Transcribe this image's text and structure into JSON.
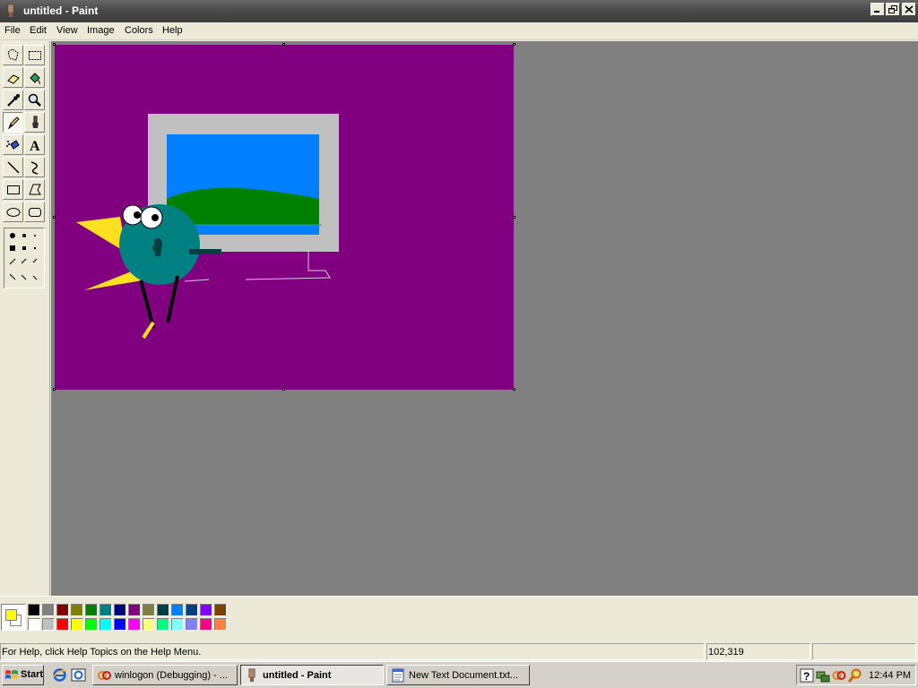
{
  "window": {
    "title": "untitled - Paint",
    "app_icon": "paint-brush-icon"
  },
  "menu": {
    "items": [
      "File",
      "Edit",
      "View",
      "Image",
      "Colors",
      "Help"
    ]
  },
  "toolbox": {
    "tools": [
      {
        "name": "free-form-select-icon"
      },
      {
        "name": "select-icon"
      },
      {
        "name": "eraser-icon"
      },
      {
        "name": "fill-with-color-icon"
      },
      {
        "name": "pick-color-icon"
      },
      {
        "name": "magnifier-icon"
      },
      {
        "name": "pencil-icon",
        "active": true
      },
      {
        "name": "brush-icon"
      },
      {
        "name": "airbrush-icon"
      },
      {
        "name": "text-icon",
        "glyph": "A"
      },
      {
        "name": "line-icon"
      },
      {
        "name": "curve-icon"
      },
      {
        "name": "rectangle-icon"
      },
      {
        "name": "polygon-icon"
      },
      {
        "name": "ellipse-icon"
      },
      {
        "name": "rounded-rectangle-icon"
      }
    ]
  },
  "colors": {
    "foreground": "#ffff00",
    "background": "#ffffff",
    "canvas": "#800080",
    "palette_top": [
      "#000000",
      "#808080",
      "#800000",
      "#808000",
      "#008000",
      "#008080",
      "#000080",
      "#800080",
      "#808040",
      "#004040",
      "#0080ff",
      "#004080",
      "#8000ff",
      "#804000"
    ],
    "palette_bottom": [
      "#ffffff",
      "#c0c0c0",
      "#ff0000",
      "#ffff00",
      "#00ff00",
      "#00ffff",
      "#0000ff",
      "#ff00ff",
      "#ffff80",
      "#00ff80",
      "#80ffff",
      "#8080ff",
      "#ff0080",
      "#ff8040"
    ]
  },
  "status": {
    "help_text": "For Help, click Help Topics on the Help Menu.",
    "coordinates": "102,319",
    "size": ""
  },
  "taskbar": {
    "start_label": "Start",
    "quick_launch": [
      "internet-explorer-icon",
      "desktop-icon"
    ],
    "tasks": [
      {
        "label": "winlogon (Debugging) - ...",
        "icon": "debugger-icon",
        "active": false
      },
      {
        "label": "untitled - Paint",
        "icon": "paint-brush-icon",
        "active": true
      },
      {
        "label": "New Text Document.txt...",
        "icon": "notepad-icon",
        "active": false
      }
    ],
    "tray_icons": [
      "help-icon",
      "network-icon",
      "debugger-icon",
      "search-icon"
    ],
    "clock": "12:44 PM"
  }
}
